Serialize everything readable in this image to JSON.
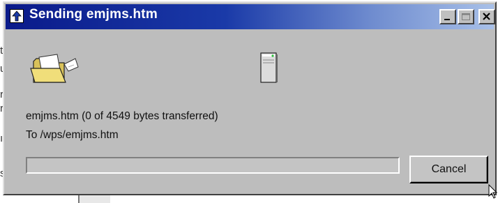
{
  "window": {
    "title": "Sending emjms.htm"
  },
  "titlebar_buttons": {
    "minimize": "minimize-icon",
    "maximize": "maximize-icon",
    "close": "close-icon"
  },
  "icons": {
    "source": "open-folder-icon",
    "destination": "server-icon"
  },
  "transfer": {
    "status": "emjms.htm (0 of 4549 bytes transferred)",
    "destination": "To /wps/emjms.htm",
    "progress_fraction": 0
  },
  "buttons": {
    "cancel_label": "Cancel"
  },
  "background_fragments": [
    "t",
    "u",
    "r",
    "r",
    "ı",
    "s"
  ],
  "colors": {
    "title_start": "#0a1a8a",
    "title_end": "#a8c0e8",
    "dialog_face": "#bdbdbd",
    "progress_fill": "#000080"
  }
}
